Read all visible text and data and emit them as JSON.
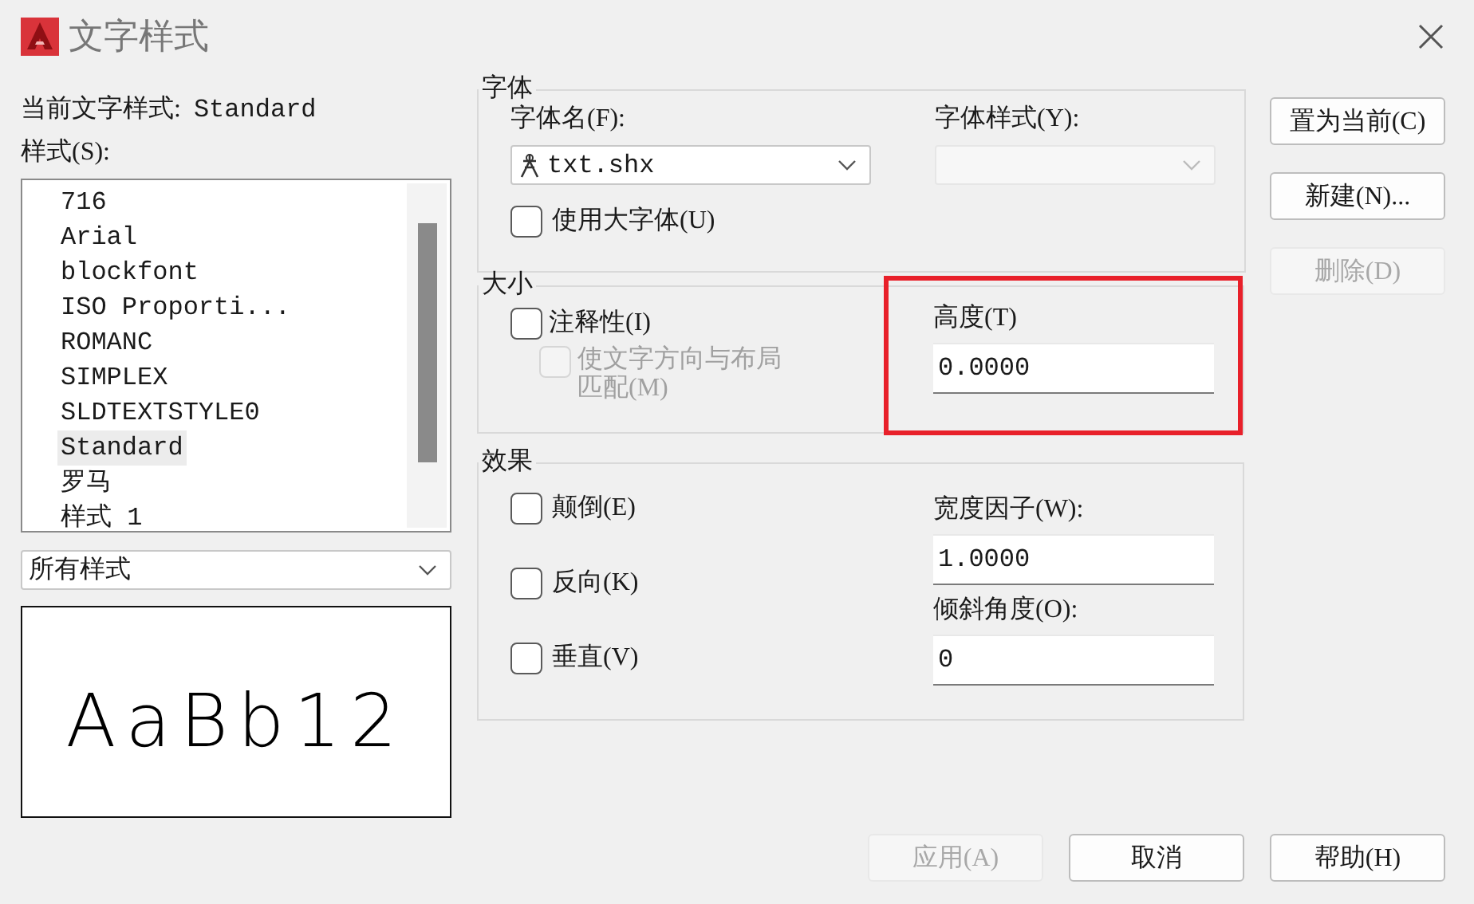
{
  "window": {
    "title": "文字样式"
  },
  "current_style": {
    "label": "当前文字样式:",
    "value": "Standard"
  },
  "styles": {
    "label": "样式(S):",
    "filter": "所有样式",
    "items": [
      {
        "name": "716",
        "selected": false
      },
      {
        "name": "Arial",
        "selected": false
      },
      {
        "name": "blockfont",
        "selected": false
      },
      {
        "name": "ISO Proporti...",
        "selected": false
      },
      {
        "name": "ROMANC",
        "selected": false
      },
      {
        "name": "SIMPLEX",
        "selected": false
      },
      {
        "name": "SLDTEXTSTYLE0",
        "selected": false
      },
      {
        "name": "Standard",
        "selected": true
      },
      {
        "name": "罗马",
        "selected": false
      },
      {
        "name": "样式 1",
        "selected": false
      }
    ]
  },
  "preview": {
    "text": "AaBb12"
  },
  "font": {
    "title": "字体",
    "font_name": {
      "label": "字体名(F):",
      "value": "txt.shx"
    },
    "font_style": {
      "label": "字体样式(Y):",
      "disabled": true
    },
    "big_font": {
      "label": "使用大字体(U)",
      "checked": false
    }
  },
  "size": {
    "title": "大小",
    "annotative": {
      "label": "注释性(I)",
      "checked": false
    },
    "match_orientation": {
      "label": "使文字方向与布局匹配(M)",
      "checked": false,
      "disabled": true
    },
    "height": {
      "label": "高度(T)",
      "value": "0.0000",
      "highlighted": true
    }
  },
  "effects": {
    "title": "效果",
    "checkboxes": [
      {
        "label": "颠倒(E)",
        "checked": false
      },
      {
        "label": "反向(K)",
        "checked": false
      },
      {
        "label": "垂直(V)",
        "checked": false
      }
    ],
    "width_factor": {
      "label": "宽度因子(W):",
      "value": "1.0000"
    },
    "oblique_angle": {
      "label": "倾斜角度(O):",
      "value": "0"
    }
  },
  "side_buttons": [
    {
      "label": "置为当前(C)",
      "disabled": false
    },
    {
      "label": "新建(N)...",
      "disabled": false
    },
    {
      "label": "删除(D)",
      "disabled": true
    }
  ],
  "footer_buttons": [
    {
      "label": "应用(A)",
      "disabled": true
    },
    {
      "label": "取消",
      "disabled": false
    },
    {
      "label": "帮助(H)",
      "disabled": false
    }
  ]
}
